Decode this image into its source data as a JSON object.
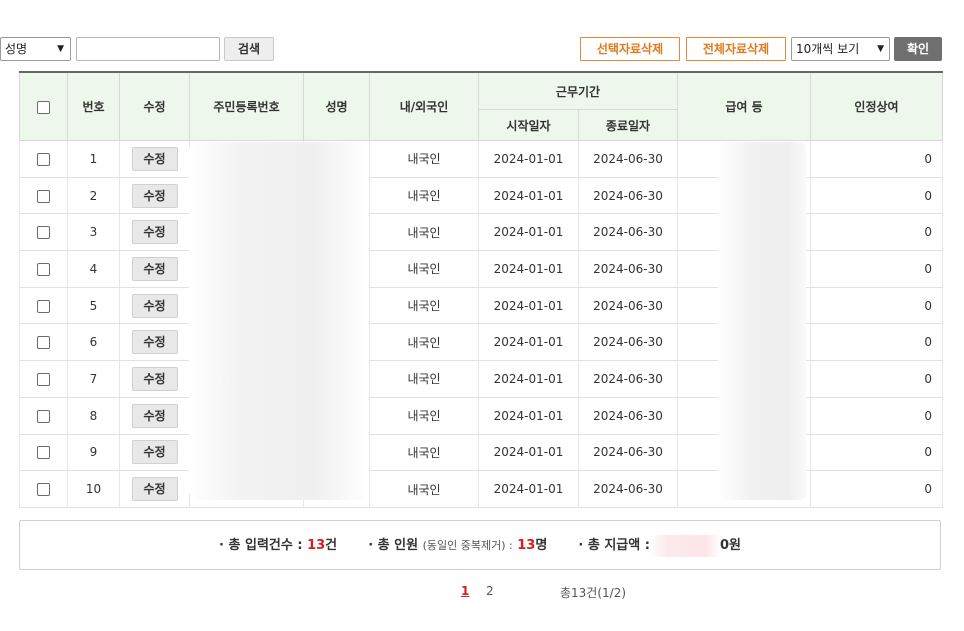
{
  "toolbar": {
    "search_field_select": "성명",
    "search_input_value": "",
    "search_button": "검색",
    "delete_selected_button": "선택자료삭제",
    "delete_all_button": "전체자료삭제",
    "page_size_select": "10개씩 보기",
    "confirm_button": "확인"
  },
  "table": {
    "headers": {
      "no": "번호",
      "edit": "수정",
      "ssn": "주민등록번호",
      "name": "성명",
      "nationality": "내/외국인",
      "period": "근무기간",
      "start": "시작일자",
      "end": "종료일자",
      "pay": "급여 등",
      "bonus": "인정상여"
    },
    "rows": [
      {
        "no": "1",
        "edit": "수정",
        "nationality": "내국인",
        "start": "2024-01-01",
        "end": "2024-06-30",
        "bonus": "0"
      },
      {
        "no": "2",
        "edit": "수정",
        "nationality": "내국인",
        "start": "2024-01-01",
        "end": "2024-06-30",
        "bonus": "0"
      },
      {
        "no": "3",
        "edit": "수정",
        "nationality": "내국인",
        "start": "2024-01-01",
        "end": "2024-06-30",
        "bonus": "0"
      },
      {
        "no": "4",
        "edit": "수정",
        "nationality": "내국인",
        "start": "2024-01-01",
        "end": "2024-06-30",
        "bonus": "0"
      },
      {
        "no": "5",
        "edit": "수정",
        "nationality": "내국인",
        "start": "2024-01-01",
        "end": "2024-06-30",
        "bonus": "0"
      },
      {
        "no": "6",
        "edit": "수정",
        "nationality": "내국인",
        "start": "2024-01-01",
        "end": "2024-06-30",
        "bonus": "0"
      },
      {
        "no": "7",
        "edit": "수정",
        "nationality": "내국인",
        "start": "2024-01-01",
        "end": "2024-06-30",
        "bonus": "0"
      },
      {
        "no": "8",
        "edit": "수정",
        "nationality": "내국인",
        "start": "2024-01-01",
        "end": "2024-06-30",
        "bonus": "0"
      },
      {
        "no": "9",
        "edit": "수정",
        "nationality": "내국인",
        "start": "2024-01-01",
        "end": "2024-06-30",
        "bonus": "0"
      },
      {
        "no": "10",
        "edit": "수정",
        "nationality": "내국인",
        "start": "2024-01-01",
        "end": "2024-06-30",
        "bonus": "0"
      }
    ]
  },
  "summary": {
    "input_count_label": "· 총 입력건수 :",
    "input_count_value": "13",
    "input_count_unit": "건",
    "people_label": "· 총 인원",
    "people_note": "(동일인 중복제거) :",
    "people_value": "13",
    "people_unit": "명",
    "total_pay_label": "· 총 지급액 :",
    "total_pay_value": "0원"
  },
  "pagination": {
    "current_page": "1",
    "next_page": "2",
    "info": "총13건(1/2)"
  },
  "colors": {
    "header_bg": "#eef7ec",
    "accent_orange": "#e07a1e",
    "highlight_red": "#d91c1c",
    "confirm_bg": "#6f6f6f"
  }
}
